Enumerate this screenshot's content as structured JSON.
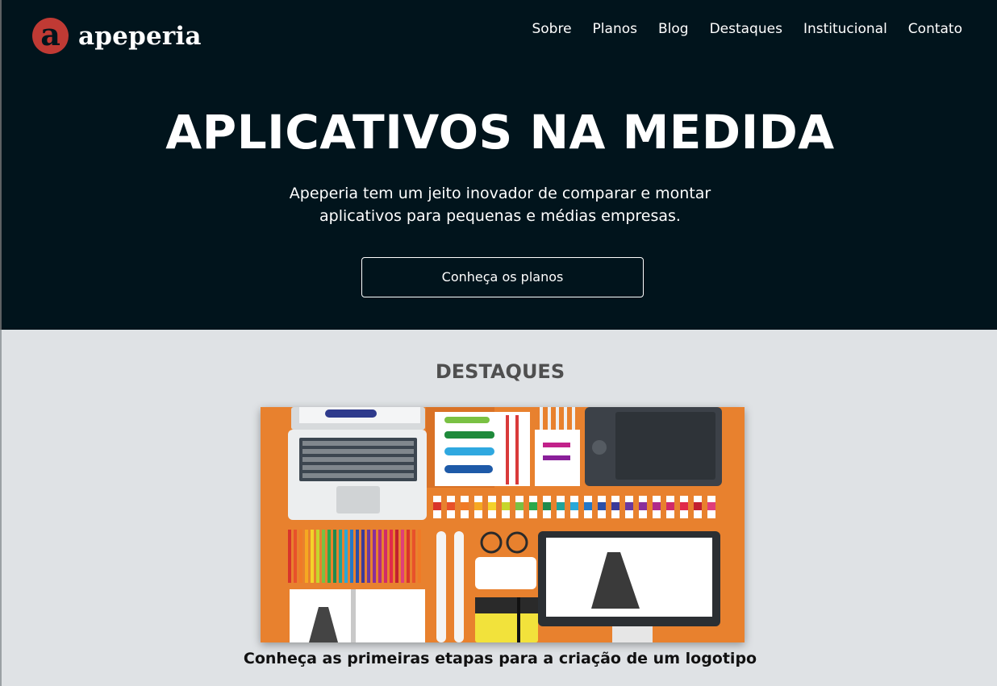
{
  "brand": {
    "logo_letter": "a",
    "name": "apeperia",
    "accent_color": "#c03a34"
  },
  "nav": {
    "items": [
      {
        "label": "Sobre"
      },
      {
        "label": "Planos"
      },
      {
        "label": "Blog"
      },
      {
        "label": "Destaques"
      },
      {
        "label": "Institucional"
      },
      {
        "label": "Contato"
      }
    ]
  },
  "hero": {
    "title": "APLICATIVOS NA MEDIDA",
    "subtitle": "Apeperia tem um jeito inovador de comparar e montar aplicativos para pequenas e médias empresas.",
    "cta_label": "Conheça os planos",
    "background_color": "#01141c"
  },
  "highlights": {
    "section_title": "DESTAQUES",
    "feature": {
      "image_icon": "designer-desk-illustration-icon",
      "caption": "Conheça as primeiras etapas para a criação de um logotipo"
    }
  }
}
